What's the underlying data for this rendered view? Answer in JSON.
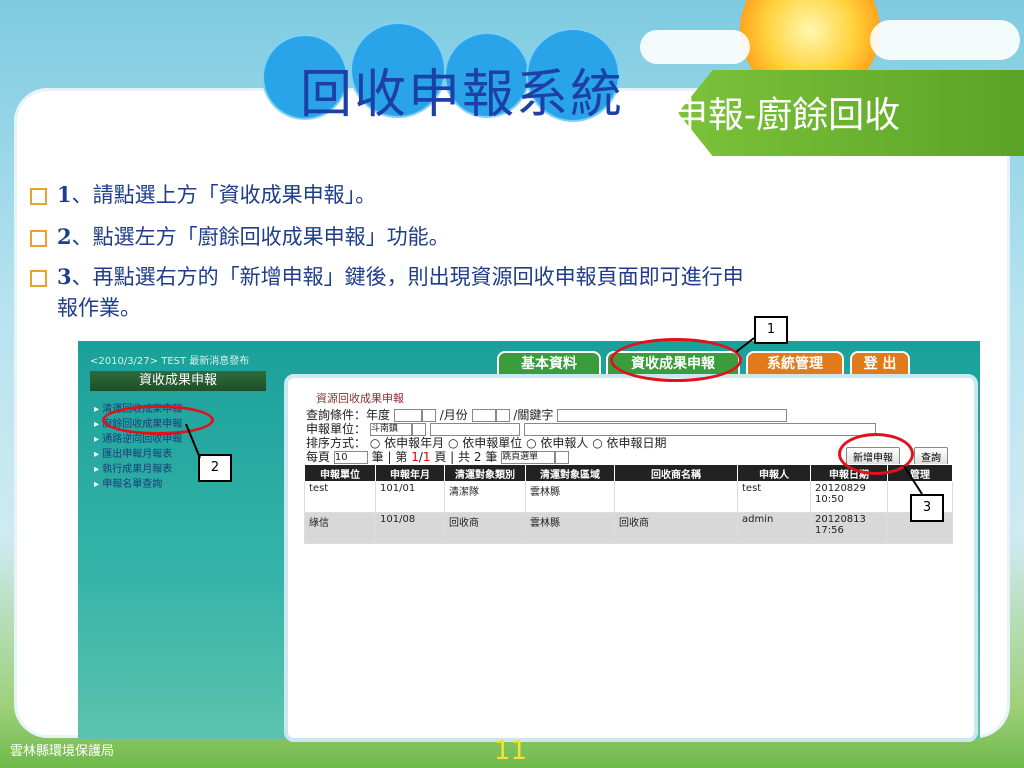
{
  "slide": {
    "title": "回收申報系統",
    "banner": "申報-廚餘回收",
    "instructions": [
      {
        "num": "1",
        "text": "、請點選上方「資收成果申報」。"
      },
      {
        "num": "2",
        "text": "、點選左方「廚餘回收成果申報」功能。"
      },
      {
        "num": "3",
        "text": "、再點選右方的「新增申報」鍵後，則出現資源回收申報頁面即可進行申"
      },
      {
        "num": "",
        "text": "報作業。"
      }
    ],
    "callouts": [
      "1",
      "2",
      "3"
    ],
    "footer": "雲林縣環境保護局",
    "page_number": "11"
  },
  "app": {
    "news_ticker": "<2010/3/27>  TEST 最新消息發布",
    "tabs": [
      "基本資料",
      "資收成果申報",
      "系統管理",
      "登 出"
    ],
    "sidebar": {
      "header": "資收成果申報",
      "items": [
        "清運回收成果申報",
        "廚餘回收成果申報",
        "通路逆向回收申報",
        "匯出申報月報表",
        "執行成果月報表",
        "申報名單查詢"
      ]
    },
    "panel": {
      "title": "資源回收成果申報",
      "query_label": "查詢條件：",
      "year_label": "年度",
      "month_label": "/月份",
      "keyword_label": "/關鍵字",
      "unit_label": "申報單位：",
      "unit_value": "斗南鎮",
      "sort_label": "排序方式：",
      "sort_options": [
        "依申報年月",
        "依申報單位",
        "依申報人",
        "依申報日期"
      ],
      "paging": {
        "prefix": "每頁",
        "size": "10",
        "text1": "筆 | 第",
        "current": "1",
        "slash": "/",
        "total_pages": "1",
        "text2": "頁 | 共",
        "count": "2",
        "text3": "筆",
        "jump": "跳頁選單"
      },
      "add_button": "新增申報",
      "query_button": "查詢",
      "columns": [
        "申報單位",
        "申報年月",
        "清運對象類別",
        "清運對象區域",
        "回收商名稱",
        "申報人",
        "申報日期",
        "管理"
      ],
      "rows": [
        [
          "test",
          "101/01",
          "清潔隊",
          "雲林縣",
          "",
          "test",
          "20120829 10:50",
          ""
        ],
        [
          "綠信",
          "101/08",
          "回收商",
          "雲林縣",
          "回收商",
          "admin",
          "20120813 17:56",
          ""
        ]
      ]
    }
  },
  "colors": {
    "title": "#1d3fa8",
    "banner": "#6cb42f",
    "accent": "#e0121c"
  }
}
